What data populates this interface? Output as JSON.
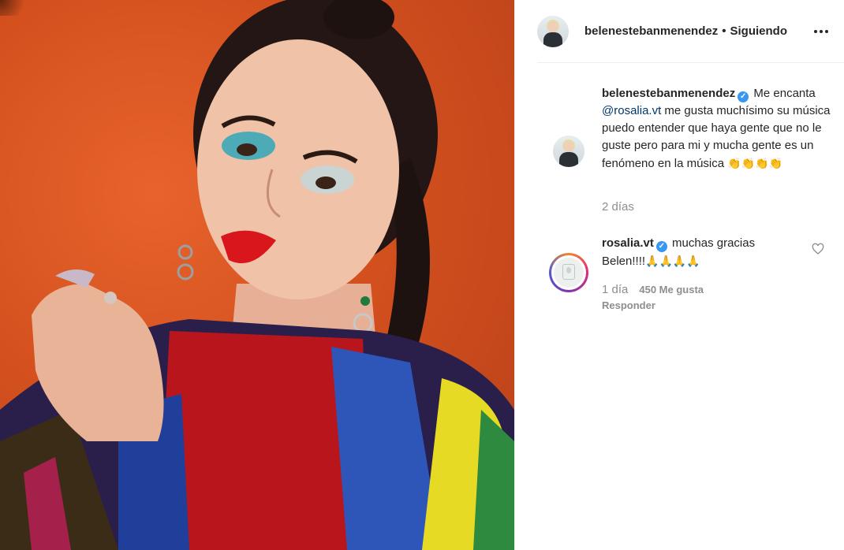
{
  "post": {
    "author": "belenestebanmenendez",
    "follow_status": "Siguiendo",
    "separator": "•",
    "more_icon": "more-options-icon"
  },
  "caption": {
    "username": "belenestebanmenendez",
    "text_before_mention": " Me encanta ",
    "mention": "@rosalia.vt",
    "text_after_mention": " me gusta muchísimo su música puedo entender que haya gente que no le guste pero para mi y mucha gente es un fenómeno en la música ",
    "emojis": "👏👏👏👏",
    "time": "2 días"
  },
  "reply": {
    "username": "rosalia.vt",
    "text": " muchas gracias Belen!!!!",
    "emojis": "🙏🙏🙏🙏",
    "time": "1 día",
    "likes": "450 Me gusta",
    "reply_label": "Responder"
  },
  "colors": {
    "text": "#262626",
    "muted": "#8e8e8e",
    "verified": "#3897f0",
    "mention": "#00376b",
    "photo_background": "#d3501e"
  }
}
